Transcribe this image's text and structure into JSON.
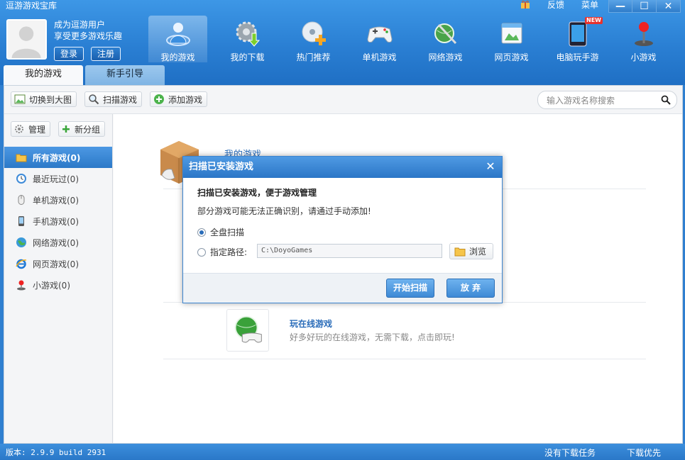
{
  "window": {
    "title": "逗游游戏宝库",
    "links": {
      "feedback": "反馈",
      "menu": "菜单"
    },
    "controls": {
      "minimize": "—",
      "maximize": "☐",
      "close": "✕"
    }
  },
  "user": {
    "line1": "成为逗游用户",
    "line2": "享受更多游戏乐趣",
    "login": "登录",
    "register": "注册"
  },
  "nav": {
    "items": [
      {
        "label": "我的游戏",
        "icon": "person-globe-icon",
        "active": true
      },
      {
        "label": "我的下载",
        "icon": "gear-download-icon"
      },
      {
        "label": "热门推荐",
        "icon": "disc-plus-icon"
      },
      {
        "label": "单机游戏",
        "icon": "gamepad-icon"
      },
      {
        "label": "网络游戏",
        "icon": "globe-sword-icon"
      },
      {
        "label": "网页游戏",
        "icon": "webpage-icon"
      },
      {
        "label": "电脑玩手游",
        "icon": "tablet-icon",
        "badge": "NEW"
      },
      {
        "label": "小游戏",
        "icon": "joystick-icon"
      }
    ]
  },
  "tabs": {
    "my_games": "我的游戏",
    "guide": "新手引导"
  },
  "toolbar": {
    "switch_big": "切换到大图",
    "scan": "扫描游戏",
    "add": "添加游戏",
    "search_placeholder": "输入游戏名称搜索"
  },
  "sidebar": {
    "manage": "管理",
    "new_group": "新分组",
    "items": [
      {
        "label": "所有游戏(0)",
        "icon": "folder-icon"
      },
      {
        "label": "最近玩过(0)",
        "icon": "clock-icon"
      },
      {
        "label": "单机游戏(0)",
        "icon": "mouse-icon"
      },
      {
        "label": "手机游戏(0)",
        "icon": "phone-icon"
      },
      {
        "label": "网络游戏(0)",
        "icon": "globe-icon"
      },
      {
        "label": "网页游戏(0)",
        "icon": "ie-icon"
      },
      {
        "label": "小游戏(0)",
        "icon": "joystick-icon"
      }
    ]
  },
  "content": {
    "my_games_title": "我的游戏",
    "online_title": "玩在线游戏",
    "online_desc": "好多好玩的在线游戏，无需下载，点击即玩!"
  },
  "dialog": {
    "title": "扫描已安装游戏",
    "heading": "扫描已安装游戏，便于游戏管理",
    "note": "部分游戏可能无法正确识别，请通过手动添加!",
    "option_full": "全盘扫描",
    "option_path": "指定路径:",
    "path_value": "C:\\DoyoGames",
    "browse": "浏览",
    "start": "开始扫描",
    "cancel": "放 弃"
  },
  "status": {
    "version": "版本: 2.9.9 build 2931",
    "no_task": "没有下载任务",
    "priority": "下载优先"
  },
  "colors": {
    "accent": "#2a7fd3",
    "link": "#2a6cb9",
    "active_item": "#3a86d3"
  }
}
